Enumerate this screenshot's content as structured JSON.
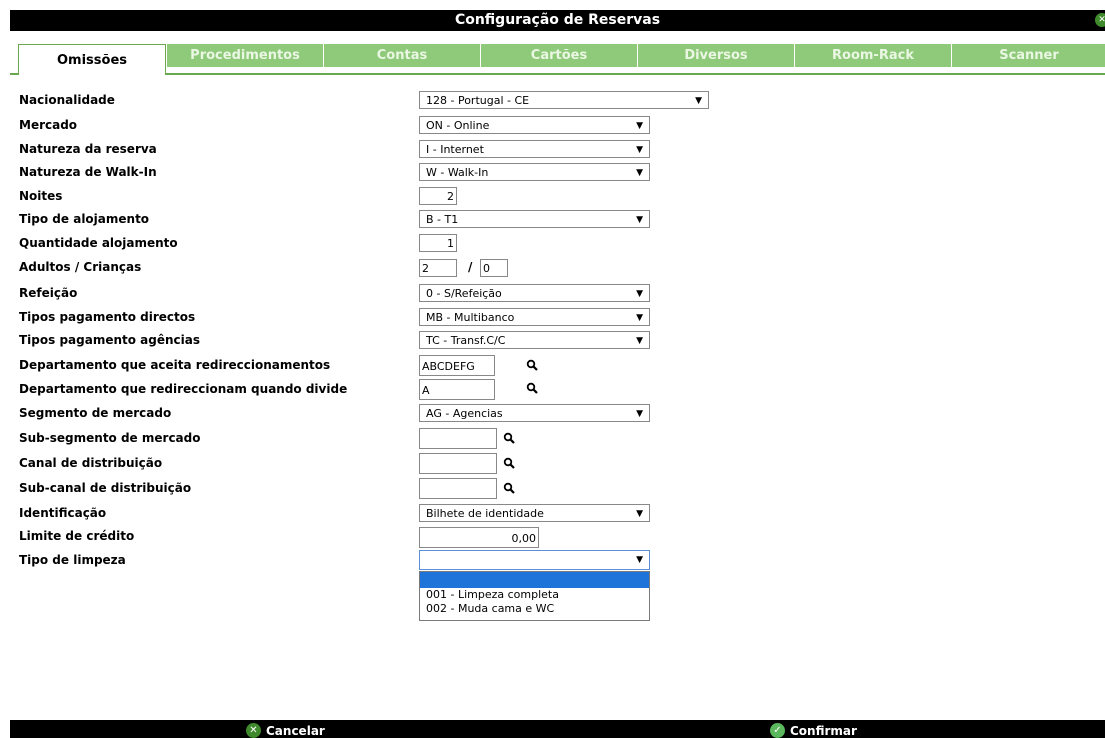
{
  "window": {
    "title": "Configuração de Reservas"
  },
  "tabs": [
    {
      "label": "Omissões",
      "active": true
    },
    {
      "label": "Procedimentos",
      "active": false
    },
    {
      "label": "Contas",
      "active": false
    },
    {
      "label": "Cartões",
      "active": false
    },
    {
      "label": "Diversos",
      "active": false
    },
    {
      "label": "Room-Rack",
      "active": false
    },
    {
      "label": "Scanner",
      "active": false
    }
  ],
  "form": {
    "nacionalidade": {
      "label": "Nacionalidade",
      "value": "128 - Portugal - CE"
    },
    "mercado": {
      "label": "Mercado",
      "value": "ON - Online"
    },
    "natureza_reserva": {
      "label": "Natureza da reserva",
      "value": "I - Internet"
    },
    "natureza_walkin": {
      "label": "Natureza de Walk-In",
      "value": "W - Walk-In"
    },
    "noites": {
      "label": "Noites",
      "value": "2"
    },
    "tipo_alojamento": {
      "label": "Tipo de alojamento",
      "value": "B - T1"
    },
    "quantidade_alojamento": {
      "label": "Quantidade alojamento",
      "value": "1"
    },
    "adultos_criancas": {
      "label": "Adultos / Crianças",
      "adultos": "2",
      "separator": "/",
      "criancas": "0"
    },
    "refeicao": {
      "label": "Refeição",
      "value": "0 - S/Refeição"
    },
    "pag_directos": {
      "label": "Tipos pagamento directos",
      "value": "MB - Multibanco"
    },
    "pag_agencias": {
      "label": "Tipos pagamento agências",
      "value": "TC - Transf.C/C"
    },
    "dept_aceita": {
      "label": "Departamento que aceita redireccionamentos",
      "value": "ABCDEFG"
    },
    "dept_redirec": {
      "label": "Departamento que redireccionam quando divide",
      "value": "A"
    },
    "segmento": {
      "label": "Segmento de mercado",
      "value": "AG - Agencias"
    },
    "sub_segmento": {
      "label": "Sub-segmento de mercado",
      "value": ""
    },
    "canal": {
      "label": "Canal de distribuição",
      "value": ""
    },
    "sub_canal": {
      "label": "Sub-canal de distribuição",
      "value": ""
    },
    "identificacao": {
      "label": "Identificação",
      "value": "Bilhete de identidade"
    },
    "limite_credito": {
      "label": "Limite de crédito",
      "value": "0,00"
    },
    "tipo_limpeza": {
      "label": "Tipo de limpeza",
      "value": "",
      "options": [
        "",
        "001 - Limpeza completa",
        "002 - Muda cama e WC"
      ]
    }
  },
  "footer": {
    "cancel_label": "Cancelar",
    "confirm_label": "Confirmar"
  },
  "colors": {
    "tab_inactive": "#8fc97a",
    "highlight": "#1e74d8",
    "bar": "#000000"
  }
}
